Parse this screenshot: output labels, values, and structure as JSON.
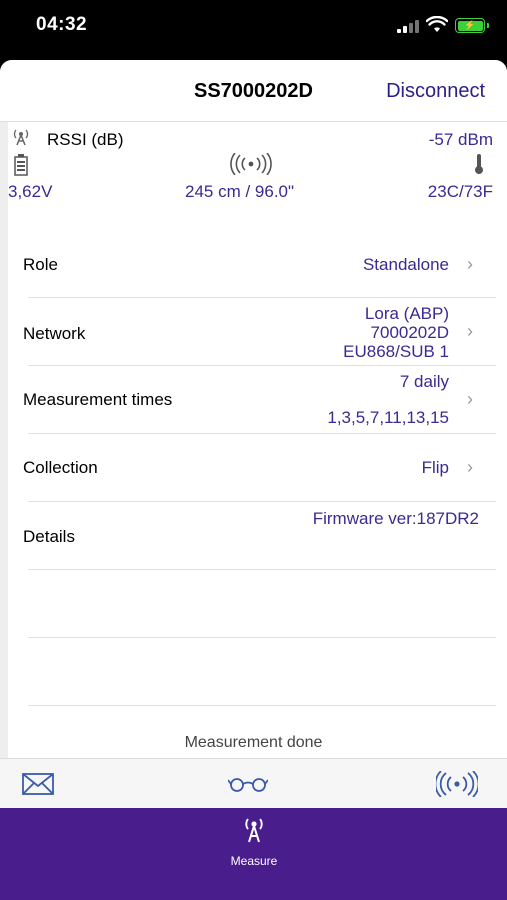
{
  "status_bar": {
    "time": "04:32"
  },
  "header": {
    "title": "SS7000202D",
    "disconnect_label": "Disconnect"
  },
  "info": {
    "rssi_label": "RSSI (dB)",
    "rssi_value": "-57 dBm",
    "voltage": "3,62V",
    "distance": "245 cm / 96.0\"",
    "temperature": "23C/73F"
  },
  "settings": {
    "role": {
      "label": "Role",
      "value": "Standalone"
    },
    "network": {
      "label": "Network",
      "line1": "Lora (ABP)",
      "line2": "7000202D",
      "line3": "EU868/SUB 1"
    },
    "measurement": {
      "label": "Measurement times",
      "line1": "7 daily",
      "line2": "1,3,5,7,11,13,15"
    },
    "collection": {
      "label": "Collection",
      "value": "Flip"
    },
    "details": {
      "label": "Details",
      "value": "Firmware ver:187DR2"
    }
  },
  "status_message": "Measurement done",
  "tabbar": {
    "measure_label": "Measure"
  },
  "colors": {
    "accent": "#3b2a8f",
    "tabbar": "#4a1d8c",
    "battery": "#3cd13c"
  }
}
